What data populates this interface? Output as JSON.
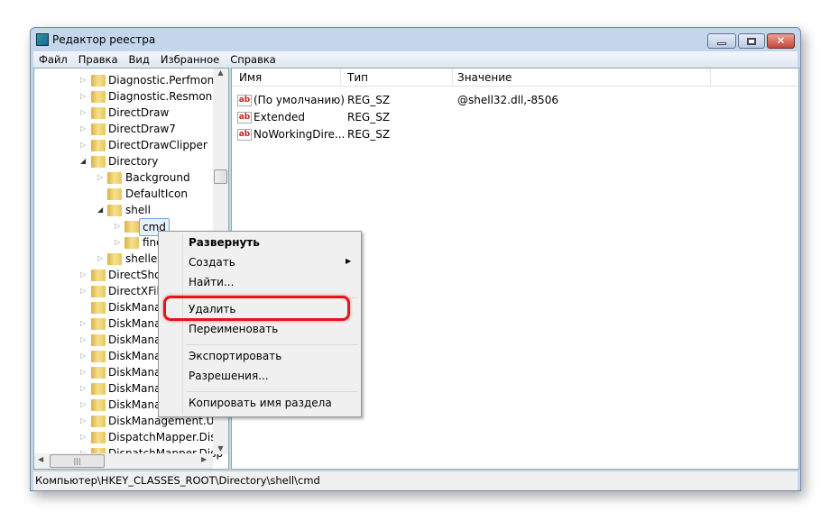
{
  "window": {
    "title": "Редактор реестра",
    "controls": [
      "minimize",
      "maximize",
      "close"
    ]
  },
  "menu": [
    "Файл",
    "Правка",
    "Вид",
    "Избранное",
    "Справка"
  ],
  "tree": [
    {
      "label": "Diagnostic.Perfmon.D",
      "level": 0,
      "expander": "collapsed"
    },
    {
      "label": "Diagnostic.Resmon.C",
      "level": 0,
      "expander": "collapsed"
    },
    {
      "label": "DirectDraw",
      "level": 0,
      "expander": "collapsed"
    },
    {
      "label": "DirectDraw7",
      "level": 0,
      "expander": "collapsed"
    },
    {
      "label": "DirectDrawClipper",
      "level": 0,
      "expander": "collapsed"
    },
    {
      "label": "Directory",
      "level": 0,
      "expander": "expanded"
    },
    {
      "label": "Background",
      "level": 1,
      "expander": "collapsed"
    },
    {
      "label": "DefaultIcon",
      "level": 1,
      "expander": "none"
    },
    {
      "label": "shell",
      "level": 1,
      "expander": "expanded"
    },
    {
      "label": "cmd",
      "level": 2,
      "expander": "collapsed",
      "selected": true
    },
    {
      "label": "find",
      "level": 2,
      "expander": "collapsed"
    },
    {
      "label": "shellex",
      "level": 1,
      "expander": "collapsed"
    },
    {
      "label": "DirectShow",
      "level": 0,
      "expander": "collapsed"
    },
    {
      "label": "DirectXFile",
      "level": 0,
      "expander": "collapsed"
    },
    {
      "label": "DiskManag",
      "level": 0,
      "expander": "none"
    },
    {
      "label": "DiskManag",
      "level": 0,
      "expander": "collapsed"
    },
    {
      "label": "DiskManag",
      "level": 0,
      "expander": "collapsed"
    },
    {
      "label": "DiskManag",
      "level": 0,
      "expander": "collapsed"
    },
    {
      "label": "DiskManag",
      "level": 0,
      "expander": "collapsed"
    },
    {
      "label": "DiskManag",
      "level": 0,
      "expander": "collapsed"
    },
    {
      "label": "DiskManag",
      "level": 0,
      "expander": "collapsed"
    },
    {
      "label": "DiskManagement.UIT",
      "level": 0,
      "expander": "collapsed"
    },
    {
      "label": "DispatchMapper.Disp",
      "level": 0,
      "expander": "collapsed"
    },
    {
      "label": "DispatchMapper.Disp",
      "level": 0,
      "expander": "collapsed"
    }
  ],
  "columns": [
    "Имя",
    "Тип",
    "Значение"
  ],
  "values": [
    {
      "name": "(По умолчанию)",
      "type": "REG_SZ",
      "data": "@shell32.dll,-8506"
    },
    {
      "name": "Extended",
      "type": "REG_SZ",
      "data": ""
    },
    {
      "name": "NoWorkingDire...",
      "type": "REG_SZ",
      "data": ""
    }
  ],
  "context_menu": [
    {
      "label": "Развернуть",
      "bold": true
    },
    {
      "label": "Создать",
      "submenu": true
    },
    {
      "label": "Найти..."
    },
    {
      "separator": true
    },
    {
      "label": "Удалить",
      "highlighted": true
    },
    {
      "label": "Переименовать"
    },
    {
      "separator": true
    },
    {
      "label": "Экспортировать"
    },
    {
      "label": "Разрешения..."
    },
    {
      "separator": true
    },
    {
      "label": "Копировать имя раздела"
    }
  ],
  "status": "Компьютер\\HKEY_CLASSES_ROOT\\Directory\\shell\\cmd",
  "colors": {
    "highlight_outline": "#e8141a",
    "titlebar": "#c4d6ec"
  }
}
